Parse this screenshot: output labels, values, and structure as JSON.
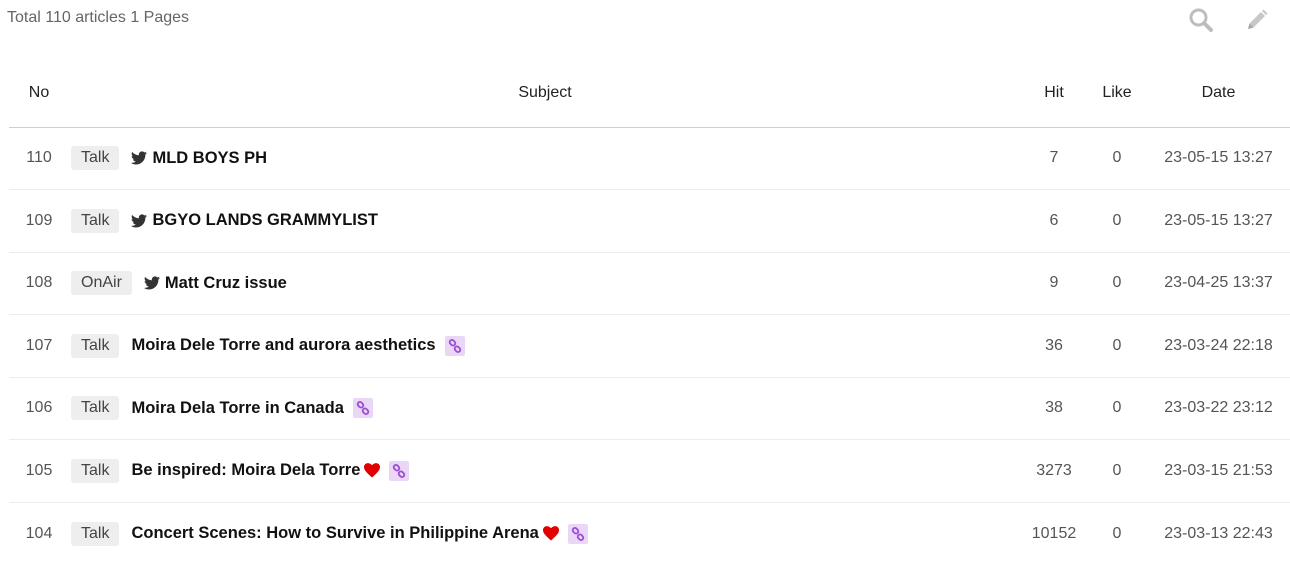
{
  "summary": "Total 110 articles 1 Pages",
  "toolbar": {
    "search_icon": "search-icon",
    "write_icon": "pencil-icon"
  },
  "columns": {
    "no": "No",
    "subject": "Subject",
    "hit": "Hit",
    "like": "Like",
    "date": "Date"
  },
  "colors": {
    "link_badge_bg": "#ead7f5",
    "link_badge_fg": "#9b4dd6",
    "heart": "#e00000",
    "category_bg": "#eeeeee"
  },
  "rows": [
    {
      "no": "110",
      "category": "Talk",
      "twitter": true,
      "title": "MLD BOYS PH",
      "heart": false,
      "link": false,
      "hit": "7",
      "like": "0",
      "date": "23-05-15 13:27"
    },
    {
      "no": "109",
      "category": "Talk",
      "twitter": true,
      "title": "BGYO LANDS GRAMMYLIST",
      "heart": false,
      "link": false,
      "hit": "6",
      "like": "0",
      "date": "23-05-15 13:27"
    },
    {
      "no": "108",
      "category": "OnAir",
      "twitter": true,
      "title": "Matt Cruz issue",
      "heart": false,
      "link": false,
      "hit": "9",
      "like": "0",
      "date": "23-04-25 13:37"
    },
    {
      "no": "107",
      "category": "Talk",
      "twitter": false,
      "title": "Moira Dele Torre and aurora aesthetics",
      "heart": false,
      "link": true,
      "hit": "36",
      "like": "0",
      "date": "23-03-24 22:18"
    },
    {
      "no": "106",
      "category": "Talk",
      "twitter": false,
      "title": "Moira Dela Torre in Canada",
      "heart": false,
      "link": true,
      "hit": "38",
      "like": "0",
      "date": "23-03-22 23:12"
    },
    {
      "no": "105",
      "category": "Talk",
      "twitter": false,
      "title": "Be inspired: Moira Dela Torre",
      "heart": true,
      "link": true,
      "hit": "3273",
      "like": "0",
      "date": "23-03-15 21:53"
    },
    {
      "no": "104",
      "category": "Talk",
      "twitter": false,
      "title": "Concert Scenes: How to Survive in Philippine Arena",
      "heart": true,
      "link": true,
      "hit": "10152",
      "like": "0",
      "date": "23-03-13 22:43"
    }
  ]
}
